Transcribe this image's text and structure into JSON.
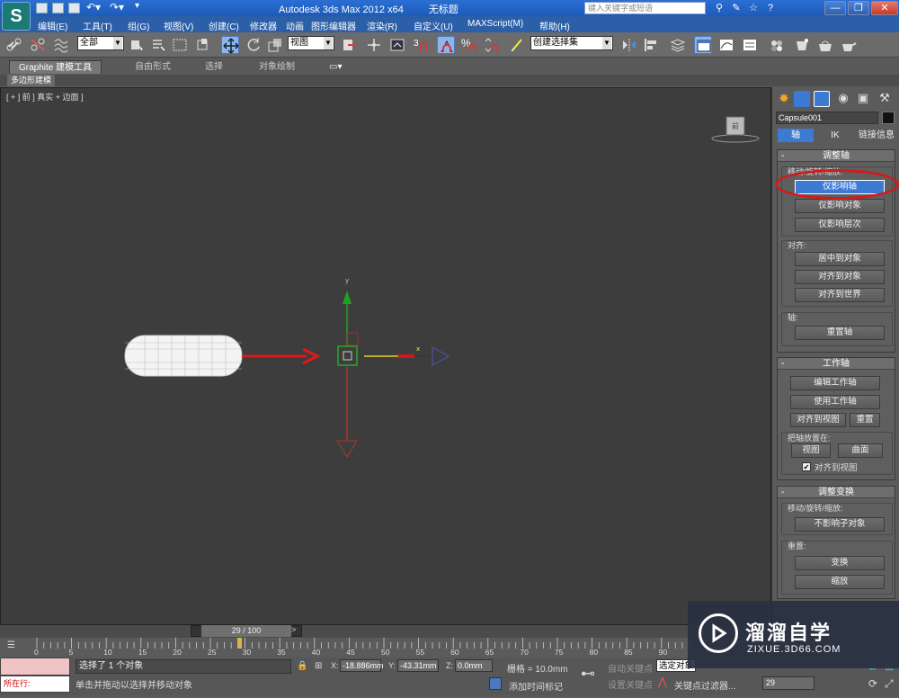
{
  "window": {
    "app_title": "Autodesk 3ds Max  2012 x64",
    "doc_title": "无标题",
    "search_placeholder": "键入关键字或短语",
    "minimize": "—",
    "restore": "❐",
    "close": "✕"
  },
  "menu": [
    "编辑(E)",
    "工具(T)",
    "组(G)",
    "视图(V)",
    "创建(C)",
    "修改器",
    "动画",
    "图形编辑器",
    "渲染(R)",
    "自定义(U)",
    "MAXScript(M)",
    "帮助(H)"
  ],
  "toolbar": {
    "selection_filter": "全部",
    "ref_coord": "视图",
    "named_selection": "创建选择集",
    "snap_label": "3",
    "percent_label": "%"
  },
  "ribbon": {
    "tabs": [
      "Graphite 建模工具",
      "自由形式",
      "选择",
      "对象绘制"
    ],
    "active_tab": 0,
    "sub_tab": "多边形建模"
  },
  "viewport": {
    "label": "[ + ] 前 ] 真实 + 边面 ]",
    "viewcube_face": "前",
    "gizmo_x": "x",
    "gizmo_y": "y",
    "object_color_selection": "#ffffff",
    "arrow_color": "#e01818"
  },
  "command_panel": {
    "object_name": "Capsule001",
    "hierarchy_tabs": [
      "轴",
      "IK",
      "链接信息"
    ],
    "active_hierarchy_tab": 0,
    "adjust_pivot": {
      "title": "调整轴",
      "move_rotate_scale_label": "移动/旋转/缩放:",
      "buttons": [
        "仅影响轴",
        "仅影响对象",
        "仅影响层次"
      ],
      "active_button": 0,
      "align_label": "对齐:",
      "align_buttons": [
        "居中到对象",
        "对齐到对象",
        "对齐到世界"
      ],
      "pivot_label": "轴:",
      "reset_pivot": "重置轴"
    },
    "working_pivot": {
      "title": "工作轴",
      "edit": "编辑工作轴",
      "use": "使用工作轴",
      "align_to_view": "对齐到视图",
      "reset": "重置",
      "place_pivot_label": "把轴放置在:",
      "view": "视图",
      "surface": "曲面",
      "align_to_view_check": "对齐到视图",
      "align_to_view_checked": true
    },
    "adjust_transform": {
      "title": "调整变换",
      "move_rotate_scale_label": "移动/旋转/缩放:",
      "dont_affect_children": "不影响子对象",
      "reset_label": "重置:",
      "transform": "变换",
      "scale": "缩放"
    }
  },
  "timeline": {
    "frame_display": "29 / 100",
    "current_frame": 29,
    "total_frames": 100,
    "ticks": [
      "0",
      "5",
      "10",
      "15",
      "20",
      "25",
      "30",
      "35",
      "40",
      "45",
      "50",
      "55",
      "60",
      "65",
      "70",
      "75",
      "80",
      "85",
      "90"
    ]
  },
  "status": {
    "maxscript_label": "所在行:",
    "selection": "选择了 1 个对象",
    "prompt": "单击并拖动以选择并移动对象",
    "x_label": "X:",
    "x_value": "-18.886mm",
    "y_label": "Y:",
    "y_value": "-43.31mm",
    "z_label": "Z:",
    "z_value": "0.0mm",
    "grid": "栅格 = 10.0mm",
    "auto_key": "自动关键点",
    "selected": "选定对象",
    "set_key": "设置关键点",
    "key_filters": "关键点过滤器...",
    "add_time_tag": "添加时间标记",
    "frame_field": "29"
  },
  "watermark": {
    "title": "溜溜自学",
    "url": "ZIXUE.3D66.COM"
  }
}
